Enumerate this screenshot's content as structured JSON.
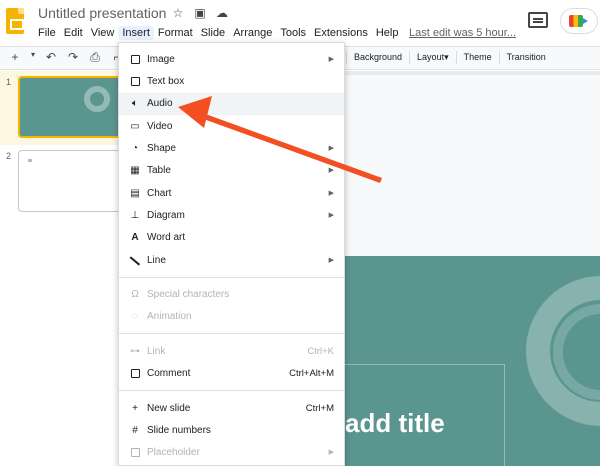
{
  "app": {
    "title": "Untitled presentation",
    "last_edit": "Last edit was 5 hour..."
  },
  "menubar": [
    "File",
    "Edit",
    "View",
    "Insert",
    "Format",
    "Slide",
    "Arrange",
    "Tools",
    "Extensions",
    "Help"
  ],
  "active_menu": "Insert",
  "toolbar": {
    "background": "Background",
    "layout": "Layout",
    "theme": "Theme",
    "transition": "Transition"
  },
  "filmstrip": {
    "slide1_num": "1",
    "slide2_num": "2"
  },
  "insert_menu": [
    {
      "label": "Image",
      "icon": "image-icon",
      "submenu": true
    },
    {
      "label": "Text box",
      "icon": "text-box-icon",
      "submenu": false
    },
    {
      "label": "Audio",
      "icon": "audio-icon",
      "submenu": false,
      "highlighted": true
    },
    {
      "label": "Video",
      "icon": "video-icon",
      "submenu": false
    },
    {
      "label": "Shape",
      "icon": "shape-icon",
      "submenu": true
    },
    {
      "label": "Table",
      "icon": "table-icon",
      "submenu": true
    },
    {
      "label": "Chart",
      "icon": "chart-icon",
      "submenu": true
    },
    {
      "label": "Diagram",
      "icon": "diagram-icon",
      "submenu": true
    },
    {
      "label": "Word art",
      "icon": "word-art-icon",
      "submenu": false
    },
    {
      "label": "Line",
      "icon": "line-icon",
      "submenu": true
    },
    {
      "label": "Special characters",
      "icon": "omega-icon",
      "disabled": true
    },
    {
      "label": "Animation",
      "icon": "animation-icon",
      "disabled": true
    },
    {
      "label": "Link",
      "icon": "link-icon",
      "disabled": true,
      "shortcut": "Ctrl+K"
    },
    {
      "label": "Comment",
      "icon": "comment-icon",
      "shortcut": "Ctrl+Alt+M"
    },
    {
      "label": "New slide",
      "icon": "plus-icon",
      "shortcut": "Ctrl+M"
    },
    {
      "label": "Slide numbers",
      "icon": "hash-icon"
    },
    {
      "label": "Placeholder",
      "icon": "placeholder-icon",
      "disabled": true,
      "submenu": true
    }
  ],
  "slide": {
    "title_text": "add title"
  },
  "colors": {
    "accent_arrow": "#f25022",
    "slide_bg": "#5b958f",
    "logo": "#f4b400",
    "selected_slide_border": "#f4b400"
  }
}
